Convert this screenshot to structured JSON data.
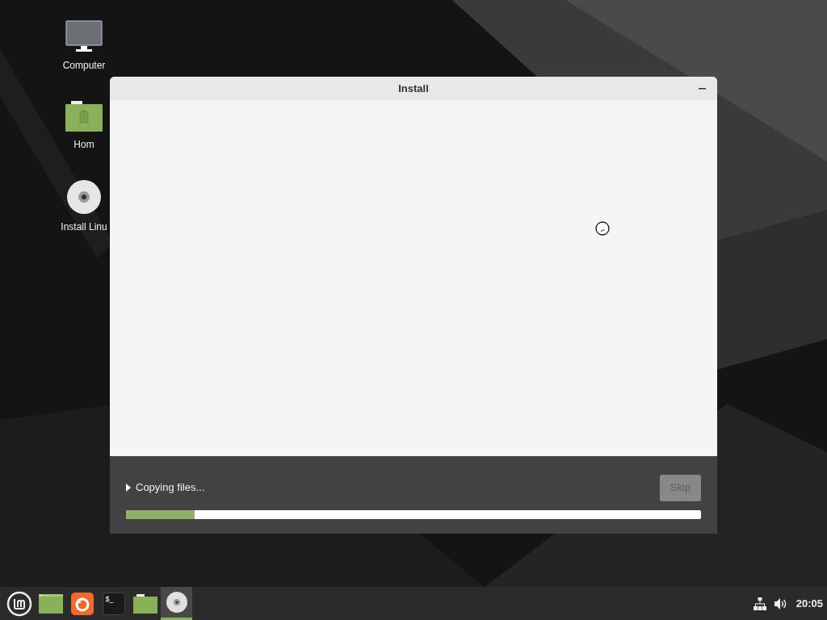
{
  "desktop_icons": [
    {
      "kind": "computer",
      "label": "Computer"
    },
    {
      "kind": "folder",
      "label": "Hom"
    },
    {
      "kind": "disc",
      "label": "Install Linu"
    }
  ],
  "window": {
    "title": "Install",
    "status": "Copying files...",
    "progress": {
      "level": 0.12
    },
    "skip_button": {
      "label": "Skip",
      "disabled": true
    }
  },
  "taskbar": {
    "items": [
      {
        "kind": "menu",
        "selected": false
      },
      {
        "kind": "desktop",
        "selected": false
      },
      {
        "kind": "browser",
        "selected": false
      },
      {
        "kind": "terminal",
        "glyph": "$_",
        "selected": false
      },
      {
        "kind": "folder",
        "selected": false
      },
      {
        "kind": "disc",
        "selected": true
      }
    ],
    "clock": "20:05"
  }
}
